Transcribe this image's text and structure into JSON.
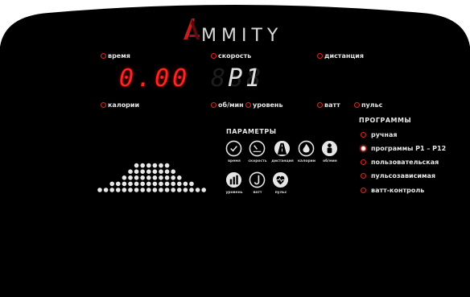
{
  "brand": {
    "name": "MMITY",
    "logo_letter": "A"
  },
  "indicators": {
    "time": "время",
    "speed": "скорость",
    "distance": "дистанция",
    "calories": "калории",
    "rpm": "об/мин",
    "level": "уровень",
    "watt": "ватт",
    "pulse": "пульс"
  },
  "displays": {
    "left": "0.00",
    "right_ghost": "888",
    "right": "P1"
  },
  "parameters": {
    "title": "ПАРАМЕТРЫ",
    "icons": [
      {
        "icon": "clock-icon",
        "label": "время"
      },
      {
        "icon": "speedometer-icon",
        "label": "скорость"
      },
      {
        "icon": "road-icon",
        "label": "дистанция"
      },
      {
        "icon": "flame-icon",
        "label": "калории"
      },
      {
        "icon": "person-icon",
        "label": "об/мин"
      },
      {
        "icon": "level-bars-icon",
        "label": "уровень"
      },
      {
        "icon": "watt-icon",
        "label": "ватт"
      },
      {
        "icon": "heart-icon",
        "label": "пульс"
      }
    ]
  },
  "programs": {
    "title": "ПРОГРАММЫ",
    "items": [
      {
        "label": "ручная",
        "active": false
      },
      {
        "label": "программы P1 – P12",
        "active": true
      },
      {
        "label": "пользовательская",
        "active": false
      },
      {
        "label": "пульсозависимая",
        "active": false
      },
      {
        "label": "ватт-контроль",
        "active": false
      }
    ]
  },
  "profile_columns": [
    1,
    1,
    2,
    2,
    3,
    4,
    5,
    5,
    5,
    5,
    5,
    5,
    4,
    3,
    2,
    2,
    1,
    1
  ],
  "colors": {
    "panel": "#000000",
    "led_red": "#d22a2a",
    "segment_red": "#ff2424",
    "text": "#e6e6e6"
  }
}
